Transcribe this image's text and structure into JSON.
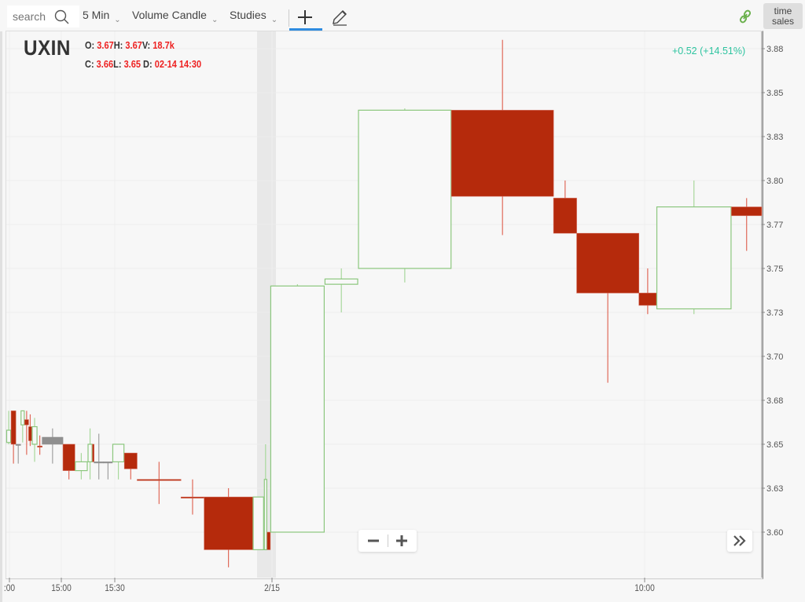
{
  "toolbar": {
    "search_placeholder": "search",
    "interval": "5 Min",
    "chart_type": "Volume Candle",
    "studies": "Studies",
    "time_sales_line1": "time",
    "time_sales_line2": "sales",
    "icons": [
      "search-icon",
      "chevron-down-icon",
      "crosshair-icon",
      "pencil-icon",
      "link-icon"
    ]
  },
  "header": {
    "symbol": "UXIN",
    "o_label": "O:",
    "o_value": "3.67",
    "h_label": "H:",
    "h_value": "3.67",
    "v_label": "V:",
    "v_value": "18.7k",
    "c_label": "C:",
    "c_value": "3.66",
    "l_label": "L:",
    "l_value": "3.65",
    "d_label": "D:",
    "d_value": "02-14 14:30",
    "change": "+0.52 (+14.51%)"
  },
  "controls": {
    "zoom_out": "−",
    "zoom_in": "+",
    "scroll_forward": "»"
  },
  "colors": {
    "up": "#8cc77e",
    "down": "#b52a0c",
    "neutral": "#8f8f8f",
    "change_text": "#2ec4a0",
    "active_tool": "#2f8ce0"
  },
  "chart_data": {
    "type": "candlestick-volume",
    "title": "UXIN 5 Min Volume Candle",
    "ylim": [
      3.585,
      3.89
    ],
    "yticks": [
      3.875,
      3.85,
      3.825,
      3.8,
      3.775,
      3.75,
      3.725,
      3.7,
      3.675,
      3.65,
      3.625,
      3.6
    ],
    "ytick_labels": [
      "3.88",
      "3.85",
      "3.83",
      "3.80",
      "3.77",
      "3.75",
      "3.73",
      "3.70",
      "3.68",
      "3.65",
      "3.63",
      "3.60"
    ],
    "xtick_labels": [
      ":00",
      "15:00",
      "15:30",
      "2/15",
      "10:00"
    ],
    "session_break_label": "2/15",
    "candles": [
      {
        "vol": 6,
        "o": 3.651,
        "h": 3.669,
        "l": 3.65,
        "c": 3.658,
        "dir": "up"
      },
      {
        "vol": 6,
        "o": 3.669,
        "h": 3.669,
        "l": 3.639,
        "c": 3.65,
        "dir": "down"
      },
      {
        "vol": 6,
        "o": 3.65,
        "h": 3.65,
        "l": 3.639,
        "c": 3.65,
        "dir": "flat"
      },
      {
        "vol": 5,
        "o": 3.661,
        "h": 3.669,
        "l": 3.651,
        "c": 3.669,
        "dir": "up"
      },
      {
        "vol": 5,
        "o": 3.664,
        "h": 3.669,
        "l": 3.644,
        "c": 3.661,
        "dir": "down"
      },
      {
        "vol": 4,
        "o": 3.66,
        "h": 3.667,
        "l": 3.649,
        "c": 3.652,
        "dir": "down"
      },
      {
        "vol": 7,
        "o": 3.65,
        "h": 3.665,
        "l": 3.64,
        "c": 3.66,
        "dir": "up"
      },
      {
        "vol": 6,
        "o": 3.649,
        "h": 3.655,
        "l": 3.644,
        "c": 3.649,
        "dir": "down"
      },
      {
        "vol": 26,
        "o": 3.654,
        "h": 3.659,
        "l": 3.639,
        "c": 3.65,
        "dir": "flat"
      },
      {
        "vol": 15,
        "o": 3.65,
        "h": 3.65,
        "l": 3.63,
        "c": 3.635,
        "dir": "down"
      },
      {
        "vol": 16,
        "o": 3.635,
        "h": 3.645,
        "l": 3.63,
        "c": 3.64,
        "dir": "up"
      },
      {
        "vol": 6,
        "o": 3.64,
        "h": 3.659,
        "l": 3.63,
        "c": 3.65,
        "dir": "up"
      },
      {
        "vol": 2,
        "o": 3.65,
        "h": 3.65,
        "l": 3.64,
        "c": 3.64,
        "dir": "down"
      },
      {
        "vol": 12,
        "o": 3.64,
        "h": 3.656,
        "l": 3.63,
        "c": 3.64,
        "dir": "flat"
      },
      {
        "vol": 11,
        "o": 3.64,
        "h": 3.64,
        "l": 3.63,
        "c": 3.64,
        "dir": "flat"
      },
      {
        "vol": 15,
        "o": 3.64,
        "h": 3.65,
        "l": 3.63,
        "c": 3.65,
        "dir": "up"
      },
      {
        "vol": 16,
        "o": 3.645,
        "h": 3.645,
        "l": 3.63,
        "c": 3.636,
        "dir": "down"
      },
      {
        "vol": 55,
        "o": 3.63,
        "h": 3.64,
        "l": 3.616,
        "c": 3.63,
        "dir": "down"
      },
      {
        "vol": 29,
        "o": 3.62,
        "h": 3.63,
        "l": 3.61,
        "c": 3.62,
        "dir": "down"
      },
      {
        "vol": 61,
        "o": 3.62,
        "h": 3.625,
        "l": 3.58,
        "c": 3.59,
        "dir": "down"
      },
      {
        "vol": 14,
        "o": 3.59,
        "h": 3.62,
        "l": 3.59,
        "c": 3.62,
        "dir": "up"
      },
      {
        "vol": 4,
        "o": 3.59,
        "h": 3.65,
        "l": 3.59,
        "c": 3.63,
        "dir": "up"
      },
      {
        "vol": 4,
        "o": 3.6,
        "h": 3.6,
        "l": 3.59,
        "c": 3.59,
        "dir": "down"
      },
      {
        "vol": 68,
        "o": 3.6,
        "h": 3.741,
        "l": 3.6,
        "c": 3.74,
        "dir": "up"
      },
      {
        "vol": 42,
        "o": 3.741,
        "h": 3.75,
        "l": 3.725,
        "c": 3.744,
        "dir": "up"
      },
      {
        "vol": 117,
        "o": 3.75,
        "h": 3.841,
        "l": 3.742,
        "c": 3.84,
        "dir": "up"
      },
      {
        "vol": 128,
        "o": 3.84,
        "h": 3.88,
        "l": 3.769,
        "c": 3.791,
        "dir": "down"
      },
      {
        "vol": 29,
        "o": 3.79,
        "h": 3.8,
        "l": 3.77,
        "c": 3.77,
        "dir": "down"
      },
      {
        "vol": 78,
        "o": 3.77,
        "h": 3.77,
        "l": 3.685,
        "c": 3.736,
        "dir": "down"
      },
      {
        "vol": 22,
        "o": 3.736,
        "h": 3.75,
        "l": 3.724,
        "c": 3.729,
        "dir": "down"
      },
      {
        "vol": 94,
        "o": 3.727,
        "h": 3.8,
        "l": 3.724,
        "c": 3.785,
        "dir": "up"
      },
      {
        "vol": 38,
        "o": 3.785,
        "h": 3.79,
        "l": 3.76,
        "c": 3.78,
        "dir": "down"
      }
    ]
  }
}
